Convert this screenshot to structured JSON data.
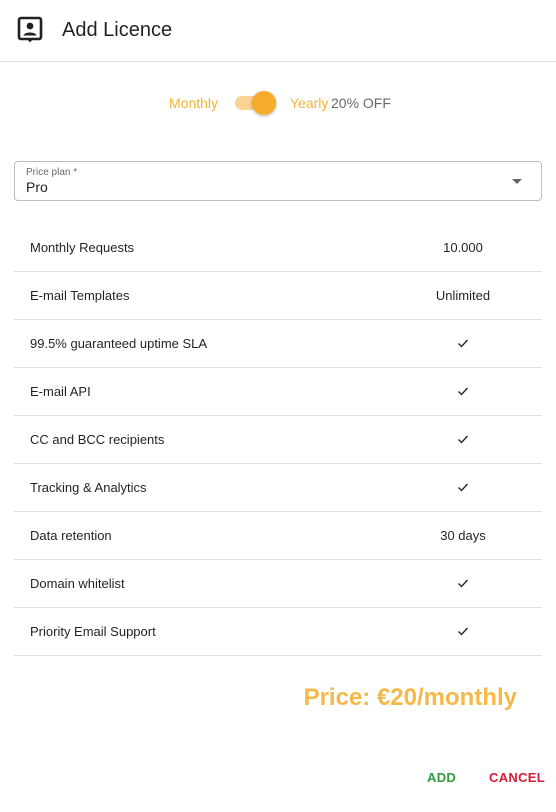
{
  "dialog": {
    "title": "Add Licence"
  },
  "billing": {
    "monthly_label": "Monthly",
    "yearly_label": "Yearly",
    "discount_label": "20% OFF",
    "toggle_on": true,
    "accent_color": "#f5b333"
  },
  "price_plan": {
    "label": "Price plan *",
    "value": "Pro"
  },
  "features": [
    {
      "name": "Monthly Requests",
      "value": "10.000",
      "check": false
    },
    {
      "name": "E-mail Templates",
      "value": "Unlimited",
      "check": false
    },
    {
      "name": "99.5% guaranteed uptime SLA",
      "value": "",
      "check": true
    },
    {
      "name": "E-mail API",
      "value": "",
      "check": true
    },
    {
      "name": "CC and BCC recipients",
      "value": "",
      "check": true
    },
    {
      "name": "Tracking & Analytics",
      "value": "",
      "check": true
    },
    {
      "name": "Data retention",
      "value": "30 days",
      "check": false
    },
    {
      "name": "Domain whitelist",
      "value": "",
      "check": true
    },
    {
      "name": "Priority Email Support",
      "value": "",
      "check": true
    }
  ],
  "price": {
    "text": "Price: €20/monthly"
  },
  "actions": {
    "add_label": "ADD",
    "cancel_label": "CANCEL",
    "add_color": "#2e9c3e",
    "cancel_color": "#d81b3a"
  }
}
